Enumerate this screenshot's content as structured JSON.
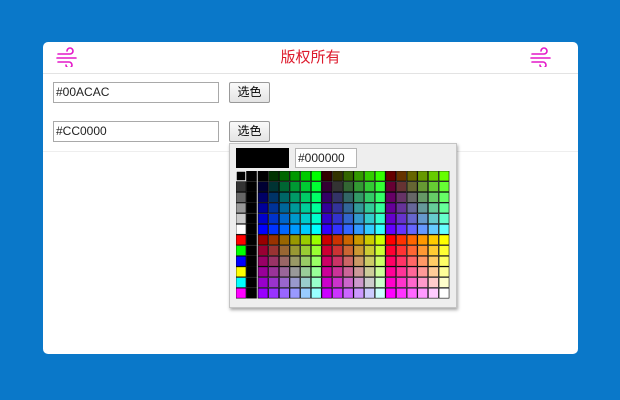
{
  "header": {
    "title": "版权所有",
    "left_icon": "wind-icon",
    "right_icon": "wind-icon",
    "icon_color": "#e418c8",
    "title_color": "#dd1a2c"
  },
  "fields": [
    {
      "value": "#00ACAC",
      "button_label": "选色"
    },
    {
      "value": "#CC0000",
      "button_label": "选色"
    }
  ],
  "color_picker": {
    "open": true,
    "preview_color": "#000000",
    "hex_value": "#000000",
    "selected_color": "#000000"
  }
}
